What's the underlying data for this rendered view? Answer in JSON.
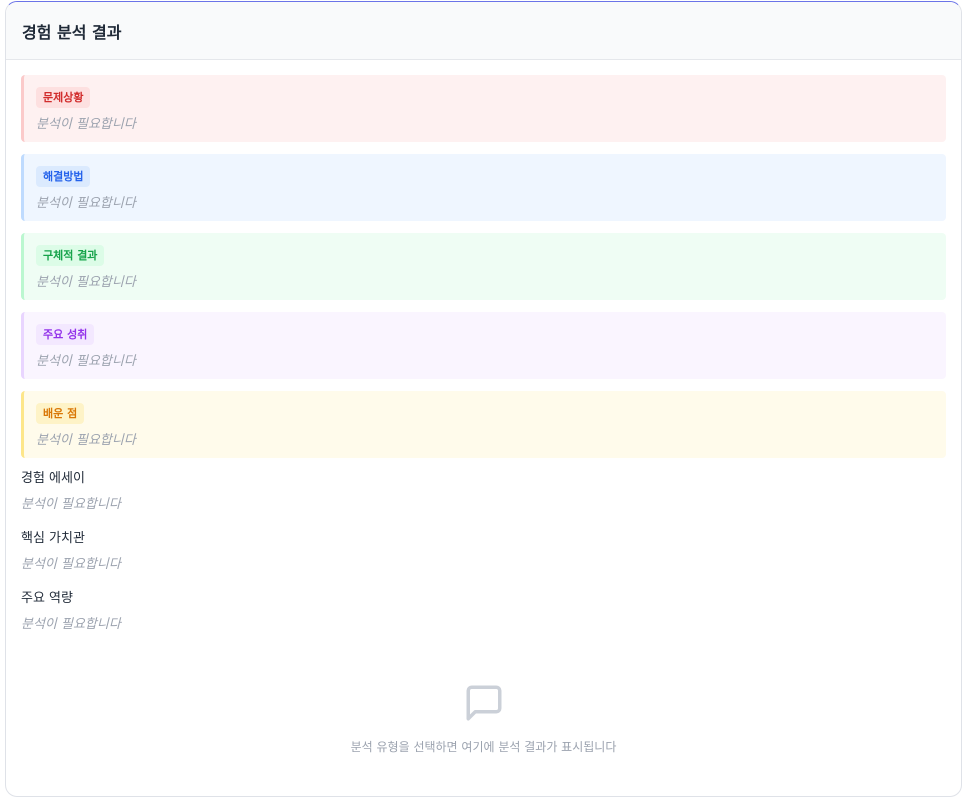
{
  "panel": {
    "title": "경험 분석 결과"
  },
  "cards": [
    {
      "id": "problem",
      "label": "문제상황",
      "text": "분석이 필요합니다"
    },
    {
      "id": "solution",
      "label": "해결방법",
      "text": "분석이 필요합니다"
    },
    {
      "id": "result",
      "label": "구체적 결과",
      "text": "분석이 필요합니다"
    },
    {
      "id": "achieve",
      "label": "주요 성취",
      "text": "분석이 필요합니다"
    },
    {
      "id": "learn",
      "label": "배운 점",
      "text": "분석이 필요합니다"
    }
  ],
  "sections": [
    {
      "title": "경험 에세이",
      "text": "분석이 필요합니다"
    },
    {
      "title": "핵심 가치관",
      "text": "분석이 필요합니다"
    },
    {
      "title": "주요 역량",
      "text": "분석이 필요합니다"
    }
  ],
  "empty_state": {
    "icon": "message-square-icon",
    "text": "분석 유형을 선택하면 여기에 분석 결과가 표시됩니다"
  },
  "colors": {
    "accent_border": "#6b73e8",
    "problem": "#d12c2c",
    "solution": "#2563eb",
    "result": "#16a34a",
    "achieve": "#9333ea",
    "learn": "#d97706"
  }
}
